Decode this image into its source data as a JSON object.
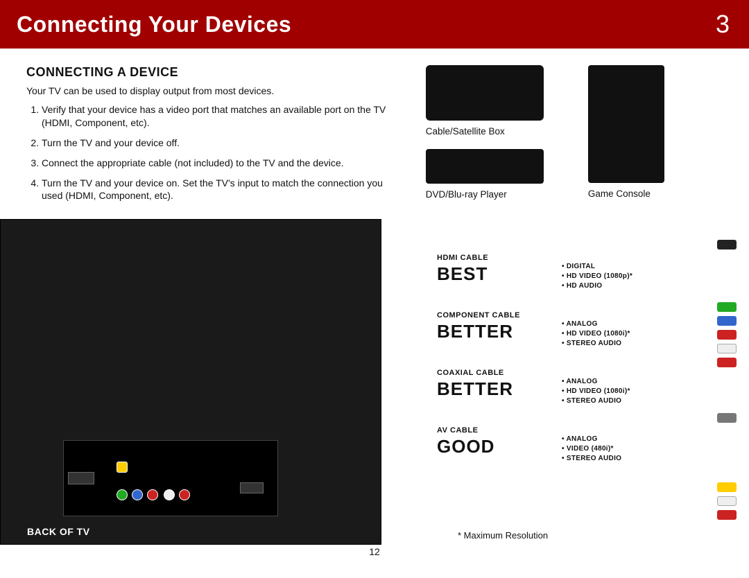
{
  "banner": {
    "title": "Connecting Your Devices",
    "chapter": "3"
  },
  "section": {
    "heading": "CONNECTING A DEVICE",
    "intro": "Your TV can be used to display output from most devices.",
    "steps": [
      "Verify that your device has a video port that matches an available port on the TV (HDMI, Component, etc).",
      "Turn the TV and your device off.",
      "Connect the appropriate cable (not included) to the TV and the device.",
      "Turn the TV and your device on. Set the TV's input to match the connection you used (HDMI, Component, etc)."
    ]
  },
  "devices": {
    "cable_box": "Cable/Satellite Box",
    "bluray": "DVD/Blu-ray Player",
    "console": "Game Console"
  },
  "diagram": {
    "back_label": "BACK OF TV"
  },
  "cables": [
    {
      "name": "HDMI CABLE",
      "rank": "BEST",
      "features": [
        "DIGITAL",
        "HD VIDEO (1080p)*",
        "HD AUDIO"
      ]
    },
    {
      "name": "COMPONENT CABLE",
      "rank": "BETTER",
      "features": [
        "ANALOG",
        "HD VIDEO (1080i)*",
        "STEREO AUDIO"
      ]
    },
    {
      "name": "COAXIAL CABLE",
      "rank": "BETTER",
      "features": [
        "ANALOG",
        "HD VIDEO (1080i)*",
        "STEREO AUDIO"
      ]
    },
    {
      "name": "AV CABLE",
      "rank": "GOOD",
      "features": [
        "ANALOG",
        "VIDEO (480i)*",
        "STEREO AUDIO"
      ]
    }
  ],
  "footnote": "* Maximum Resolution",
  "page_number": "12"
}
